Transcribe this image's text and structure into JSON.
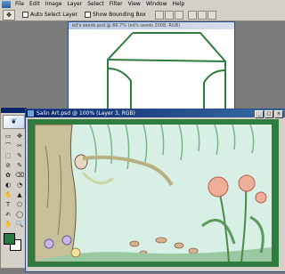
{
  "menubar": {
    "items": [
      "File",
      "Edit",
      "Image",
      "Layer",
      "Select",
      "Filter",
      "View",
      "Window",
      "Help"
    ]
  },
  "options": {
    "auto_select_label": "Auto Select Layer",
    "bounding_box_label": "Show Bounding Box"
  },
  "doc_back": {
    "title": "ed's seeds.psd @ 66.7% (ed's seeds 2008, RGB)"
  },
  "doc_front": {
    "title": "Salin Art.psd @ 100% (Layer 3, RGB)"
  },
  "toolbox": {
    "tools": [
      "▭",
      "✥",
      "⌒",
      "✂",
      "⬚",
      "✎",
      "⊘",
      "✎",
      "✿",
      "⌫",
      "◐",
      "◔",
      "✋",
      "▲",
      "T",
      "⬠",
      "✍",
      "◯",
      "✋",
      "🔍"
    ]
  },
  "colors": {
    "foreground": "#237a3a",
    "background": "#ffffff",
    "frame": "#2e7d3e"
  }
}
